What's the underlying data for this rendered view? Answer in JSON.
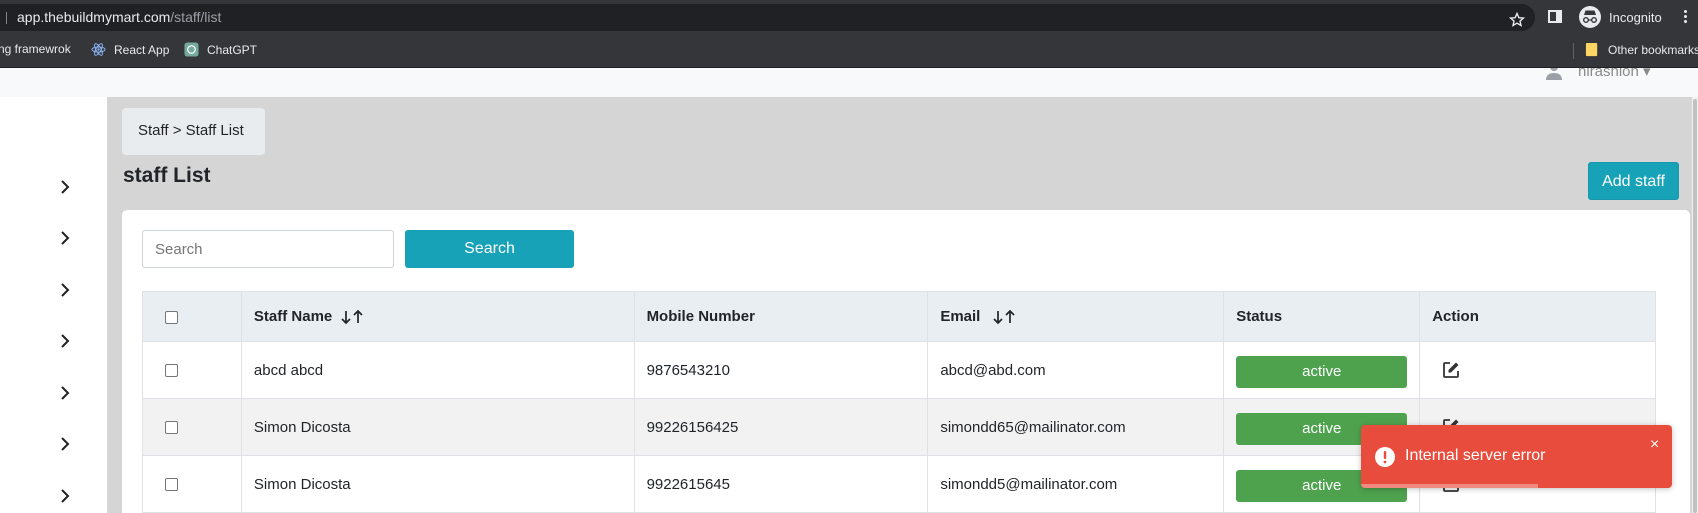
{
  "browser": {
    "url_host": "app.thebuildmymart.com",
    "url_path": "/staff/list",
    "profile_label": "Incognito",
    "bookmarks": [
      {
        "label": "ng framewrok",
        "icon": "page-icon"
      },
      {
        "label": "React App",
        "icon": "react-icon"
      },
      {
        "label": "ChatGPT",
        "icon": "chatgpt-icon"
      }
    ],
    "other_bookmarks": "Other bookmarks"
  },
  "topnav": {
    "user_name": "nirashion"
  },
  "sidebar": {
    "item_count": 7
  },
  "breadcrumb": {
    "text": "Staff > Staff List"
  },
  "page": {
    "title": "staff List",
    "add_button": "Add staff"
  },
  "search": {
    "placeholder": "Search",
    "button": "Search"
  },
  "table": {
    "headers": {
      "name": "Staff Name",
      "mobile": "Mobile Number",
      "email": "Email",
      "status": "Status",
      "action": "Action"
    },
    "rows": [
      {
        "name": "abcd abcd",
        "mobile": "9876543210",
        "email": "abcd@abd.com",
        "status": "active"
      },
      {
        "name": "Simon Dicosta",
        "mobile": "99226156425",
        "email": "simondd65@mailinator.com",
        "status": "active"
      },
      {
        "name": "Simon Dicosta",
        "mobile": "9922615645",
        "email": "simondd5@mailinator.com",
        "status": "active"
      }
    ]
  },
  "toast": {
    "message": "Internal server error",
    "close": "×",
    "color": "#e74c3c",
    "progress": 0.57
  },
  "colors": {
    "accent": "#17a2b8",
    "status_active": "#4ea24e"
  }
}
